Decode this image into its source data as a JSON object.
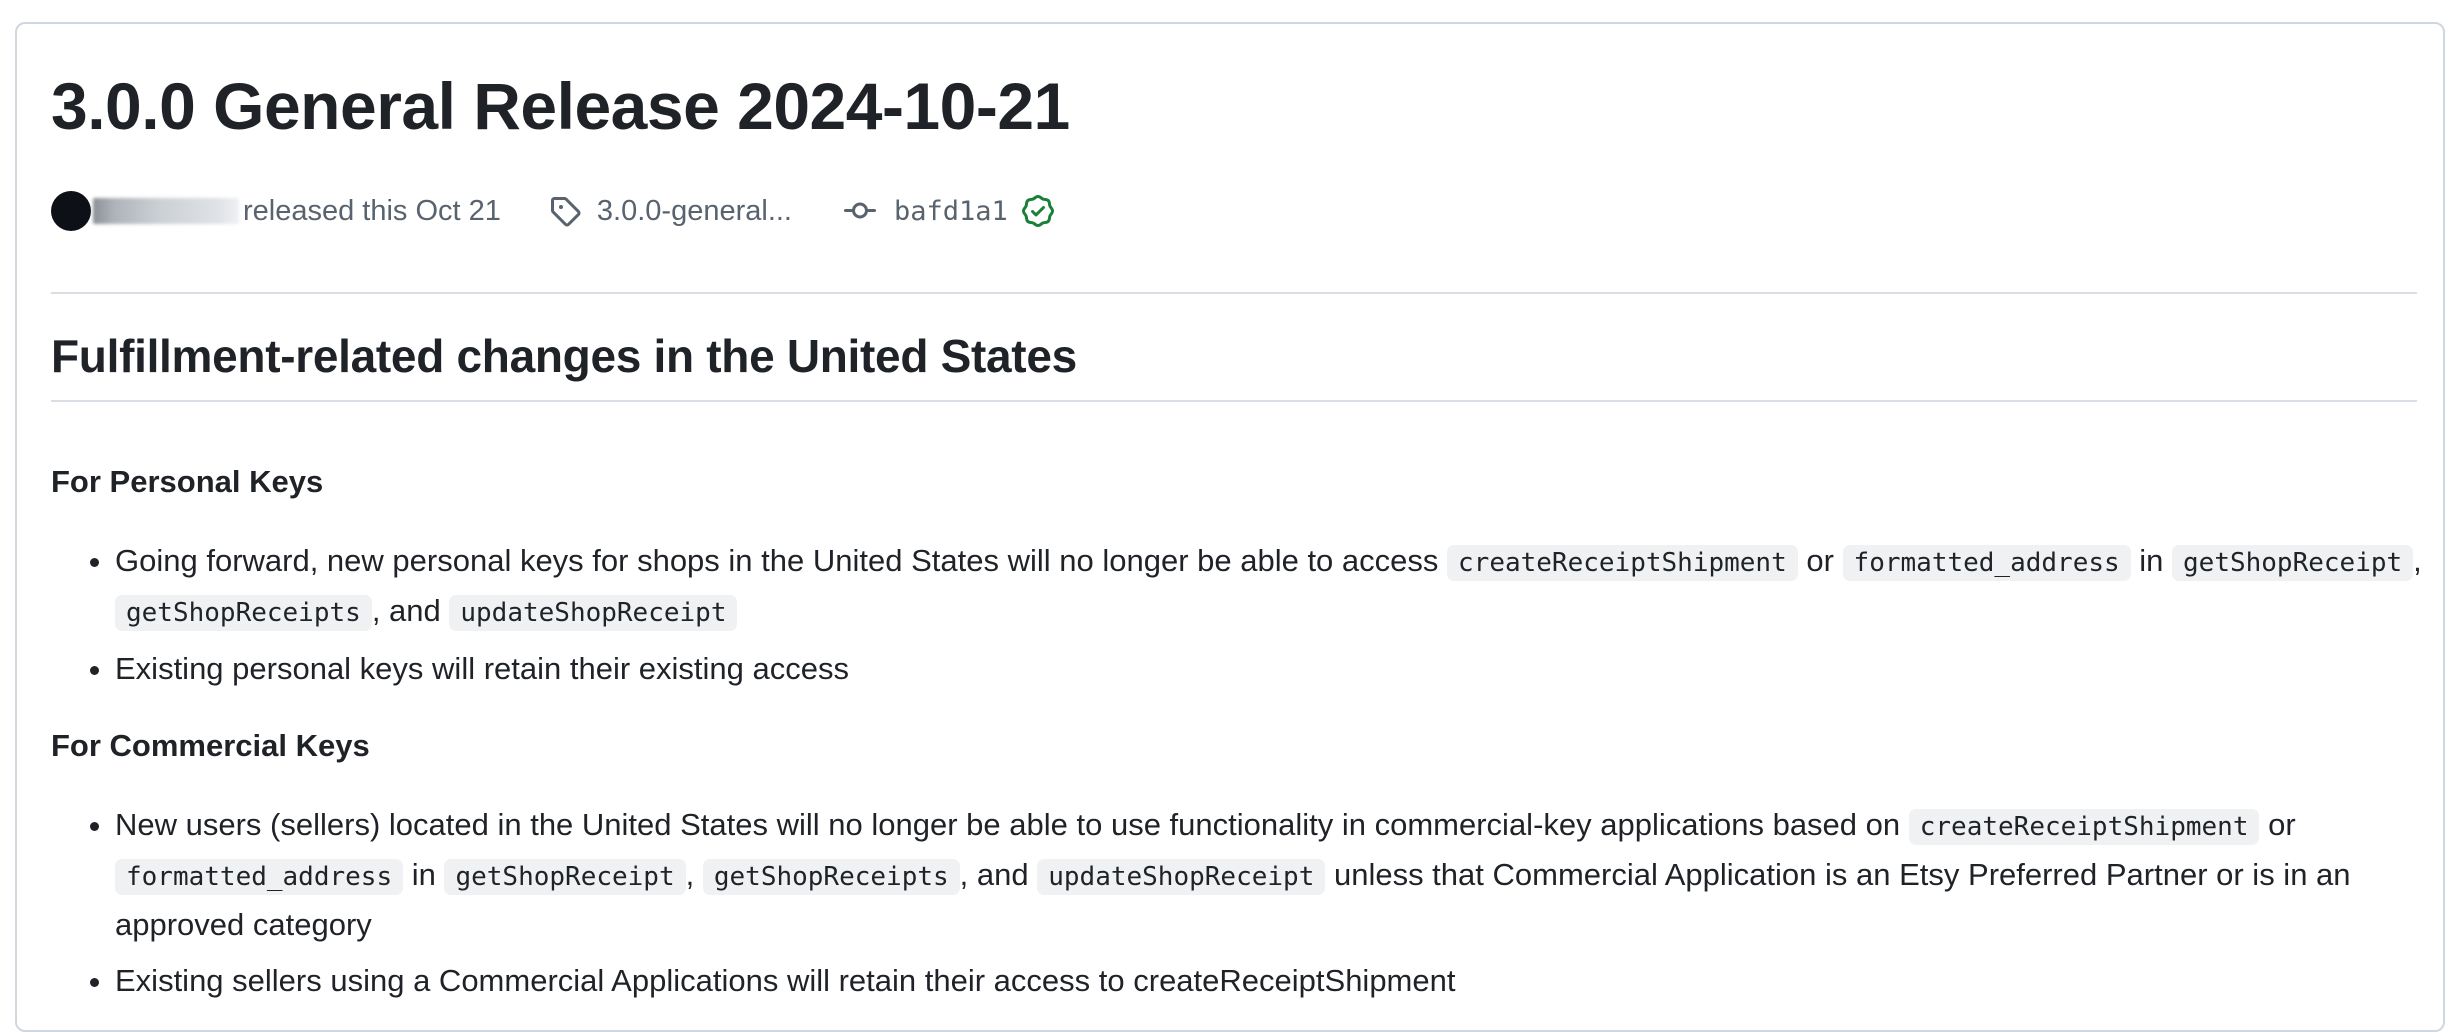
{
  "release": {
    "title": "3.0.0 General Release 2024-10-21",
    "released_text": "released this Oct 21",
    "tag": "3.0.0-general...",
    "commit": "bafd1a1"
  },
  "notes": {
    "heading": "Fulfillment-related changes in the United States",
    "sections": [
      {
        "heading": "For Personal Keys",
        "items": [
          {
            "parts": [
              "Going forward, new personal keys for shops in the United States will no longer be able to access ",
              "createReceiptShipment",
              " or ",
              "formatted_address",
              " in ",
              "getShopReceipt",
              ", ",
              "getShopReceipts",
              ", and ",
              "updateShopReceipt"
            ]
          },
          {
            "text": "Existing personal keys will retain their existing access"
          }
        ]
      },
      {
        "heading": "For Commercial Keys",
        "items": [
          {
            "parts": [
              "New users (sellers) located in the United States will no longer be able to use functionality in commercial-key applications based on ",
              "createReceiptShipment",
              " or ",
              "formatted_address",
              " in ",
              "getShopReceipt",
              ", ",
              "getShopReceipts",
              ", and ",
              "updateShopReceipt",
              " unless that Commercial Application is an Etsy Preferred Partner or is in an approved category"
            ]
          },
          {
            "text": "Existing sellers using a Commercial Applications will retain their access to createReceiptShipment"
          }
        ]
      }
    ]
  },
  "colors": {
    "text": "#1f2328",
    "muted": "#59636e",
    "border": "#d0d7de",
    "code_bg": "#eff1f3",
    "verified": "#1a7f37"
  },
  "icons": [
    "tag-icon",
    "git-commit-icon",
    "verified-icon"
  ]
}
